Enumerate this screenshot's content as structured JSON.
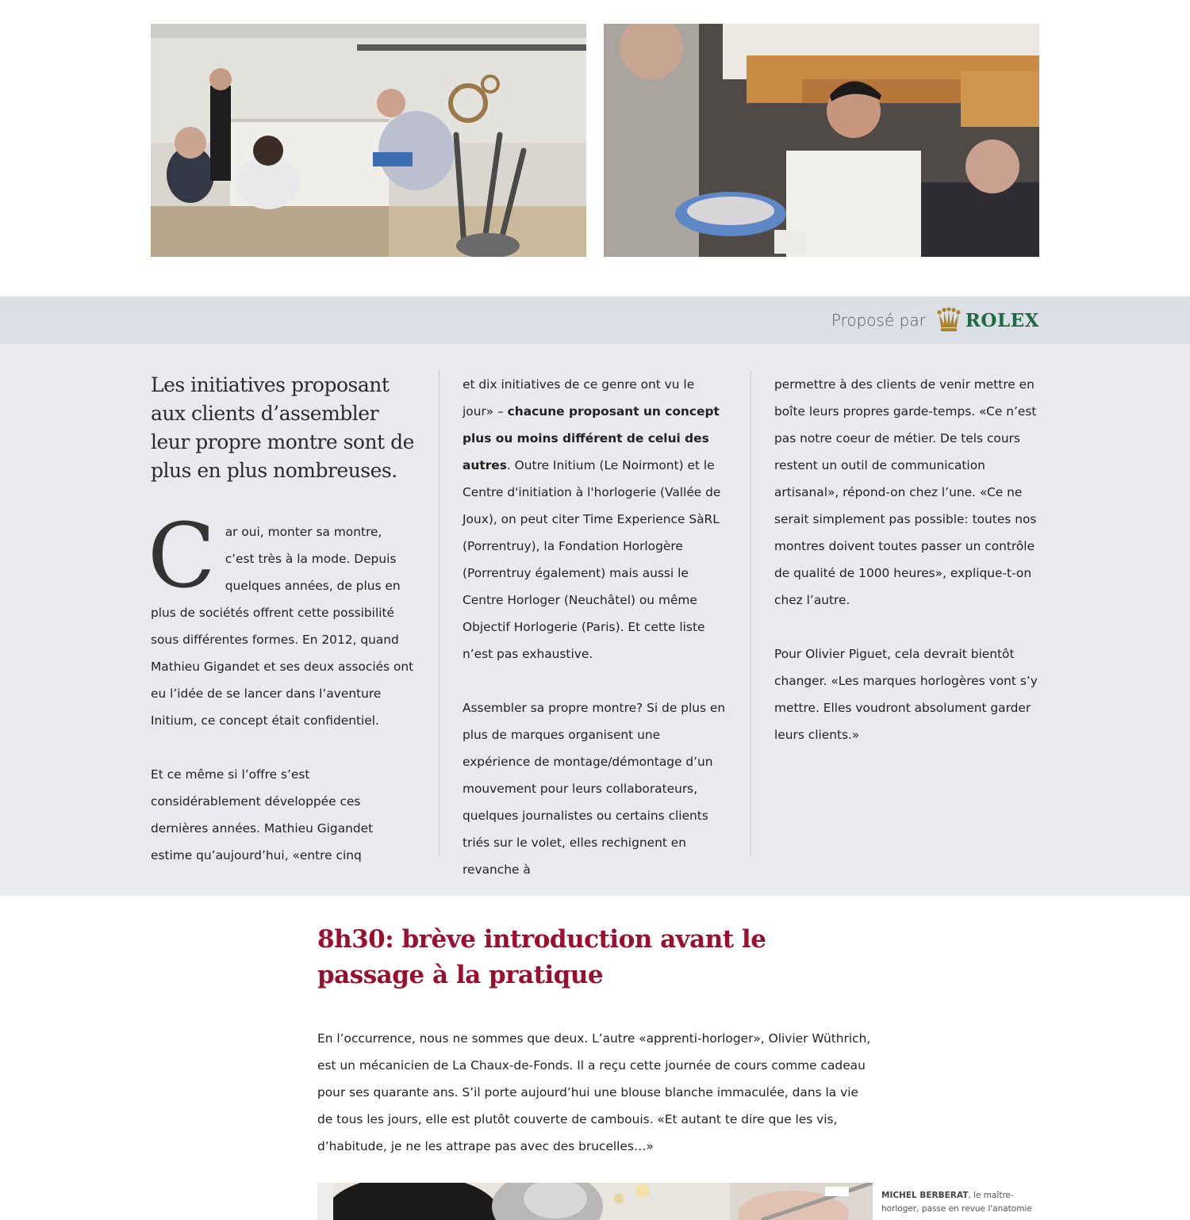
{
  "sponsor": {
    "label": "Proposé par",
    "brand": "ROLEX",
    "brand_color": "#1d6b43",
    "crown_color": "#a98434",
    "crown_icon": "crown-icon"
  },
  "photos": [
    {
      "icon": "photo-workshop-group"
    },
    {
      "icon": "photo-workshop-discussion"
    }
  ],
  "section": {
    "lead": "Les initiatives proposant aux clients d’assembler leur propre montre sont de plus en plus nombreuses.",
    "dropcap": "C",
    "col1_p1": "ar oui, monter sa montre, c’est très à la mode. Depuis quelques années, de plus en plus de sociétés offrent cette possibilité sous différentes formes. En 2012, quand Mathieu Gigandet et ses deux associés ont eu l’idée de se lancer dans l’aventure Initium, ce concept était confidentiel.",
    "col1_p2": "Et ce même si l’offre s’est considérablement développée ces dernières années. Mathieu Gigandet estime qu’aujourd’hui, «entre cinq",
    "col2_p1_start": "et dix initiatives de ce genre ont vu le jour» – ",
    "col2_p1_bold": "chacune proposant un concept plus ou moins différent de celui des autres",
    "col2_p1_end": ". Outre Initium (Le Noirmont) et le Centre d'initiation à l'horlogerie (Vallée de Joux), on peut citer Time Experience SàRL (Porrentruy), la Fondation Horlogère (Porrentruy également) mais aussi le Centre Horloger (Neuchâtel) ou même Objectif Horlogerie (Paris). Et cette liste n’est pas exhaustive.",
    "col2_p2": "Assembler sa propre montre? Si de plus en plus de marques organisent une expérience de montage/démontage d’un mouvement pour leurs collaborateurs, quelques journalistes ou certains clients triés sur le volet, elles rechignent en revanche à",
    "col3_p1": "permettre à des clients de venir mettre en boîte leurs propres garde-temps. «Ce n’est pas notre coeur de métier. De tels cours restent un outil de communication artisanal», répond-on chez l’une. «Ce ne serait simplement pas possible: toutes nos montres doivent toutes passer un contrôle de qualité de 1000 heures», explique-t-on chez l’autre.",
    "col3_p2": "Pour Olivier Piguet, cela devrait bientôt changer. «Les marques horlogères vont s’y mettre. Elles voudront absolument garder leurs clients.»"
  },
  "chapter": {
    "title": "8h30: brève introduction avant le passage à la pratique",
    "title_color": "#9b0f2e",
    "text": "En l’occurrence, nous ne sommes que deux. L’autre «apprenti-horloger», Olivier Wüthrich, est un mécanicien de La Chaux-de-Fonds. Il a reçu cette journée de cours comme cadeau pour ses quarante ans. S’il porte aujourd’hui une blouse blanche immaculée, dans la vie de tous les jours, elle est plutôt couverte de cambouis. «Et autant te dire que les vis, d’habitude, je ne les attrape pas avec des brucelles…»"
  },
  "caption": {
    "name": "MICHEL BERBERAT",
    "text": ", le maître-horloger, passe en revue l'anatomie"
  }
}
